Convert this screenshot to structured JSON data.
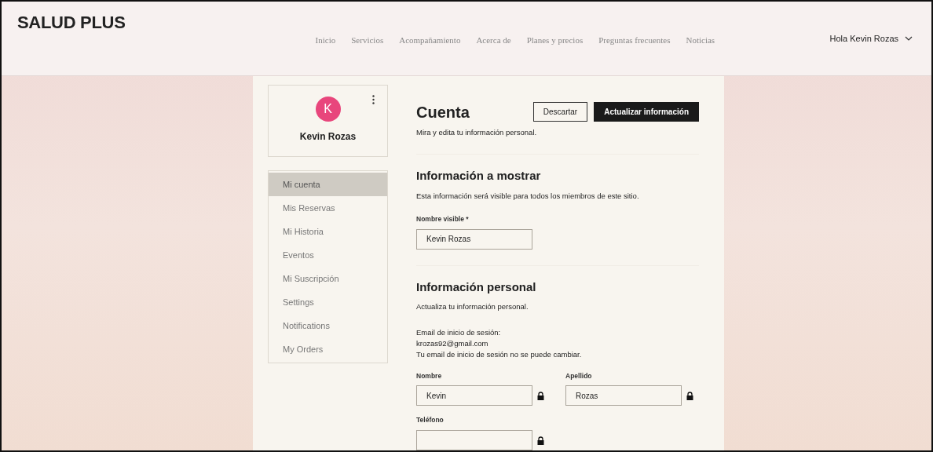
{
  "header": {
    "logo": "SALUD PLUS",
    "nav": [
      {
        "label": "Inicio",
        "selected": false
      },
      {
        "label": "Servicios",
        "selected": false
      },
      {
        "label": "Acompañamiento",
        "selected": false
      },
      {
        "label": "Acerca de",
        "selected": false
      },
      {
        "label": "Planes y precios",
        "selected": false
      },
      {
        "label": "Preguntas frecuentes",
        "selected": false
      },
      {
        "label": "Noticias",
        "selected": false
      }
    ],
    "user_menu": {
      "label": "Hola Kevin Rozas"
    }
  },
  "profile": {
    "initial": "K",
    "name": "Kevin Rozas"
  },
  "sidebar": {
    "items": [
      {
        "label": "Mi cuenta",
        "selected": true
      },
      {
        "label": "Mis Reservas",
        "selected": false
      },
      {
        "label": "Mi Historia",
        "selected": false
      },
      {
        "label": "Eventos",
        "selected": false
      },
      {
        "label": "Mi Suscripción",
        "selected": false
      },
      {
        "label": "Settings",
        "selected": false
      },
      {
        "label": "Notifications",
        "selected": false
      },
      {
        "label": "My Orders",
        "selected": false
      }
    ]
  },
  "account": {
    "title": "Cuenta",
    "subtitle": "Mira y edita tu información personal.",
    "buttons": [
      {
        "label": "Descartar",
        "kind": "secondary"
      },
      {
        "label": "Actualizar información",
        "kind": "primary"
      }
    ],
    "sections": [
      {
        "title": "Información a mostrar",
        "description": "Esta información será visible para todos los miembros de este sitio.",
        "fields": [
          {
            "label": "Nombre visible *",
            "value": "Kevin Rozas",
            "locked": false
          }
        ]
      },
      {
        "title": "Información personal",
        "description": "Actualiza tu información personal.",
        "email_label": "Email de inicio de sesión:",
        "email": "krozas92@gmail.com",
        "email_note": "Tu email de inicio de sesión no se puede cambiar.",
        "fields": [
          {
            "label": "Nombre",
            "value": "Kevin",
            "locked": true
          },
          {
            "label": "Apellido",
            "value": "Rozas",
            "locked": true
          },
          {
            "label": "Teléfono",
            "locked": true
          }
        ]
      }
    ]
  }
}
